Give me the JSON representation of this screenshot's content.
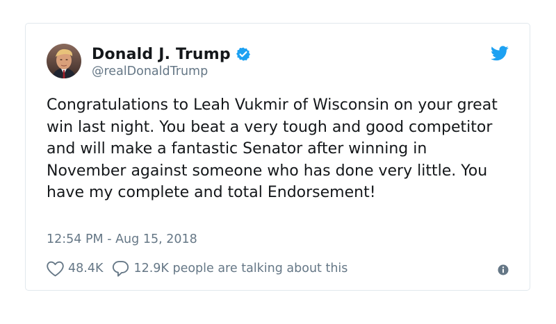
{
  "author": {
    "name": "Donald J. Trump",
    "handle": "@realDonaldTrump",
    "avatar_icon": "profile-photo",
    "verified_icon": "verified-badge-icon"
  },
  "brand_icon": "twitter-bird-icon",
  "tweet": {
    "text": "Congratulations to Leah Vukmir of Wisconsin on your great win last night. You beat a very tough and good competitor and will make a fantastic Senator after winning in November against someone who has done very little. You have my complete and total Endorsement!",
    "timestamp": "12:54 PM - Aug 15, 2018"
  },
  "actions": {
    "likes": "48.4K",
    "talking": "12.9K people are talking about this"
  },
  "colors": {
    "text": "#14171a",
    "muted": "#657786",
    "brand": "#1da1f2",
    "border": "#e1e8ed"
  }
}
